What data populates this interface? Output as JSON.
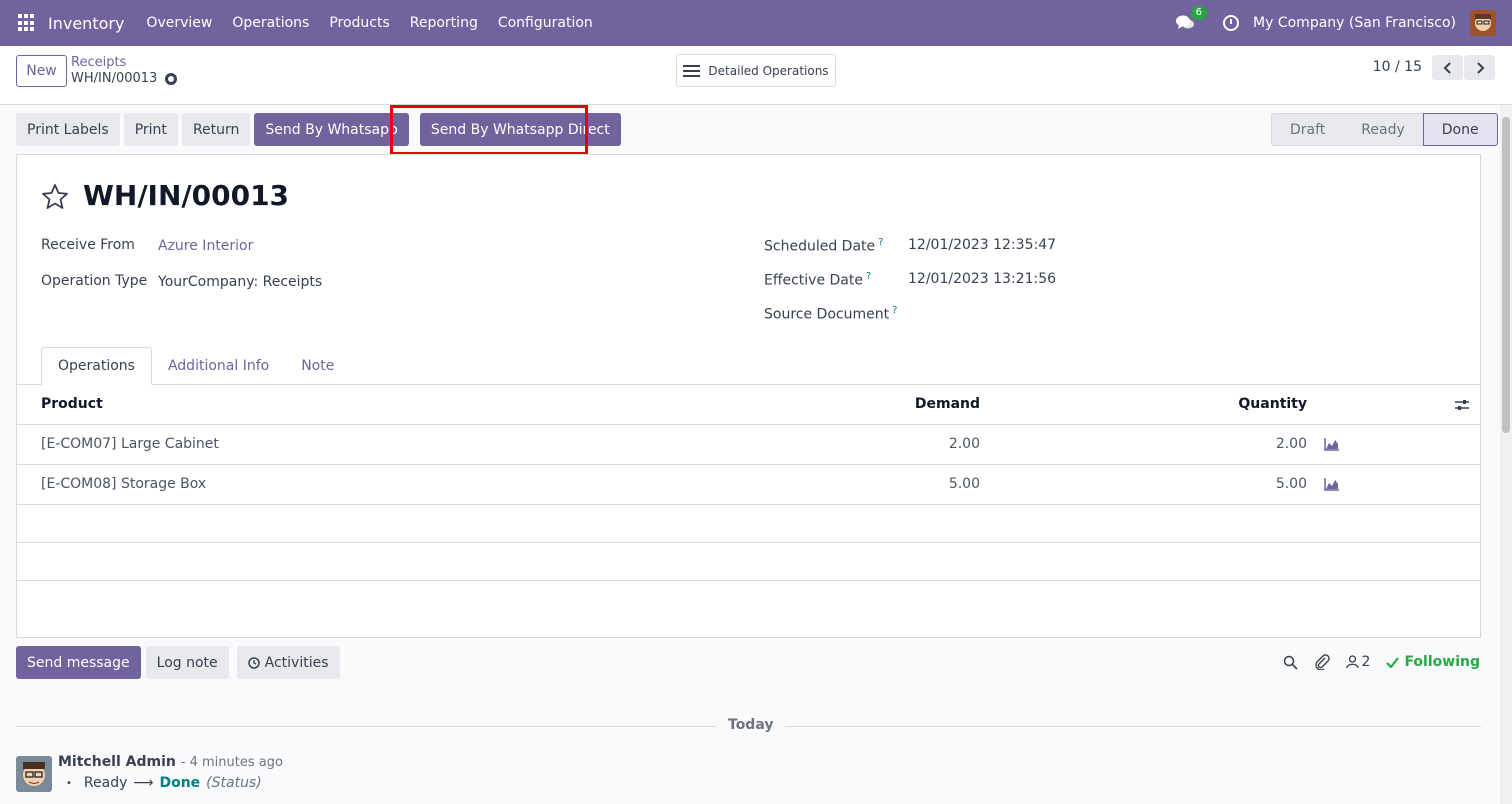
{
  "navbar": {
    "brand": "Inventory",
    "menu": [
      "Overview",
      "Operations",
      "Products",
      "Reporting",
      "Configuration"
    ],
    "chat_count": "6",
    "company": "My Company (San Francisco)"
  },
  "control": {
    "new_label": "New",
    "breadcrumb": "Receipts",
    "record_name": "WH/IN/00013",
    "detailed_label": "Detailed Operations",
    "pager": "10 / 15"
  },
  "actions": {
    "print_labels": "Print Labels",
    "print": "Print",
    "return": "Return",
    "send_whatsapp": "Send By Whatsapp",
    "send_whatsapp_direct": "Send By Whatsapp Direct"
  },
  "status": {
    "stages": [
      "Draft",
      "Ready",
      "Done"
    ],
    "current": "Done"
  },
  "form": {
    "title": "WH/IN/00013",
    "receive_from_label": "Receive From",
    "receive_from": "Azure Interior",
    "operation_type_label": "Operation Type",
    "operation_type": "YourCompany: Receipts",
    "scheduled_date_label": "Scheduled Date",
    "scheduled_date": "12/01/2023 12:35:47",
    "effective_date_label": "Effective Date",
    "effective_date": "12/01/2023 13:21:56",
    "source_document_label": "Source Document",
    "help_mark": "?"
  },
  "tabs": [
    "Operations",
    "Additional Info",
    "Note"
  ],
  "table": {
    "headers": {
      "product": "Product",
      "demand": "Demand",
      "quantity": "Quantity"
    },
    "rows": [
      {
        "product": "[E-COM07] Large Cabinet",
        "demand": "2.00",
        "quantity": "2.00"
      },
      {
        "product": "[E-COM08] Storage Box",
        "demand": "5.00",
        "quantity": "5.00"
      }
    ]
  },
  "chatter": {
    "send_message": "Send message",
    "log_note": "Log note",
    "activities": "Activities",
    "followers_count": "2",
    "following": "Following",
    "today": "Today",
    "author": "Mitchell Admin",
    "time": "- 4 minutes ago",
    "old_value": "Ready",
    "arrow": "⟶",
    "new_value": "Done",
    "field": "(Status)"
  },
  "colors": {
    "primary": "#71639e",
    "highlight": "#e60000",
    "success": "#28a745"
  }
}
